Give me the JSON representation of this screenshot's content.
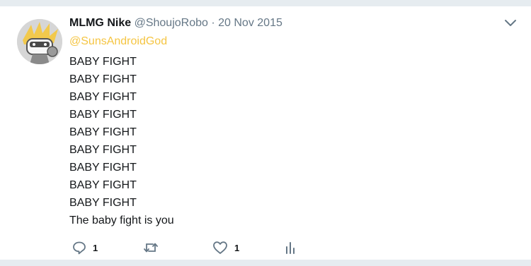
{
  "tweet": {
    "display_name": "MLMG Nike",
    "handle": "@ShoujoRobo",
    "separator": "·",
    "date": "20 Nov 2015",
    "reply_to": "@SunsAndroidGod",
    "lines": [
      "BABY FIGHT",
      "BABY FIGHT",
      "BABY FIGHT",
      "BABY FIGHT",
      "BABY FIGHT",
      "BABY FIGHT",
      "BABY FIGHT",
      "BABY FIGHT",
      "BABY FIGHT",
      "The baby fight is you"
    ],
    "actions": {
      "reply_count": "1",
      "retweet_count": "",
      "like_count": "1"
    },
    "icons": [
      "chevron-down-icon",
      "reply-icon",
      "retweet-icon",
      "heart-icon",
      "analytics-icon"
    ],
    "colors": {
      "reply_to": "#f5c542",
      "secondary_text": "#657786",
      "primary_text": "#14171a"
    }
  }
}
